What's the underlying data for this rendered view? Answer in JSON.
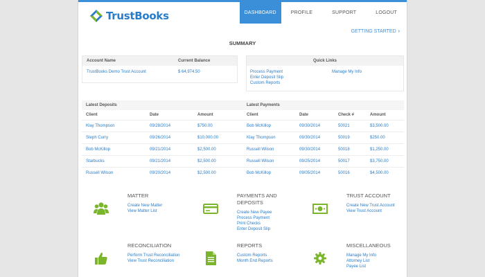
{
  "brand": {
    "name": "TrustBooks"
  },
  "nav": [
    {
      "label": "DASHBOARD"
    },
    {
      "label": "PROFILE"
    },
    {
      "label": "SUPPORT"
    },
    {
      "label": "LOGOUT"
    }
  ],
  "getting_started": "GETTING STARTED",
  "summary_title": "SUMMARY",
  "accounts": {
    "col_name": "Account Name",
    "col_balance": "Current Balance",
    "name": "TrustBooks Demo Trust Account",
    "balance": "$ 64,974.50"
  },
  "quick_links": {
    "title": "Quick Links",
    "left": [
      "Process Payment",
      "Enter Deposit Slip",
      "Custom Reports"
    ],
    "right": [
      "Manage My Info"
    ]
  },
  "deposits": {
    "title": "Latest Deposits",
    "headers": [
      "Client",
      "Date",
      "Amount"
    ],
    "rows": [
      [
        "Klay Thompson",
        "09/28/2014",
        "$750.00"
      ],
      [
        "Steph Curry",
        "09/26/2014",
        "$10,000.00"
      ],
      [
        "Bob McKillop",
        "09/21/2014",
        "$2,500.00"
      ],
      [
        "Starbucks",
        "09/21/2014",
        "$2,500.00"
      ],
      [
        "Russell Wilson",
        "09/20/2014",
        "$2,500.00"
      ]
    ]
  },
  "payments": {
    "title": "Latest Payments",
    "headers": [
      "Client",
      "Date",
      "Check #",
      "Amount"
    ],
    "rows": [
      [
        "Bob McKillop",
        "09/30/2014",
        "50021",
        "$3,500.00"
      ],
      [
        "Klay Thompson",
        "09/30/2014",
        "50019",
        "$250.00"
      ],
      [
        "Russell Wilson",
        "09/30/2014",
        "50018",
        "$1,250.00"
      ],
      [
        "Russell Wilson",
        "09/25/2014",
        "50017",
        "$3,750.00"
      ],
      [
        "Bob McKillop",
        "09/05/2014",
        "50016",
        "$4,500.00"
      ]
    ]
  },
  "sections": {
    "matter": {
      "title": "MATTER",
      "links": [
        "Create New Matter",
        "View Matter List"
      ],
      "icon": "users-icon"
    },
    "payments": {
      "title": "PAYMENTS AND DEPOSITS",
      "links": [
        "Create New Payee",
        "Process Payment",
        "Print Checks",
        "Enter Deposit Slip"
      ],
      "icon": "credit-card-icon"
    },
    "trust": {
      "title": "TRUST ACCOUNT",
      "links": [
        "Create New Trust Account",
        "View Trust Account"
      ],
      "icon": "banknote-icon"
    },
    "reconciliation": {
      "title": "RECONCILIATION",
      "links": [
        "Perform Trust Reconciliation",
        "View Trust Reconciliation"
      ],
      "icon": "thumbs-up-icon"
    },
    "reports": {
      "title": "REPORTS",
      "links": [
        "Custom Reports",
        "Month End Reports"
      ],
      "icon": "document-icon"
    },
    "misc": {
      "title": "MISCELLANEOUS",
      "links": [
        "Manage My Info",
        "Attorney List",
        "Payee List"
      ],
      "icon": "gear-icon"
    }
  },
  "colors": {
    "accent": "#3b8fd9",
    "icon_green": "#7ab52b",
    "link": "#2a7cc8"
  }
}
